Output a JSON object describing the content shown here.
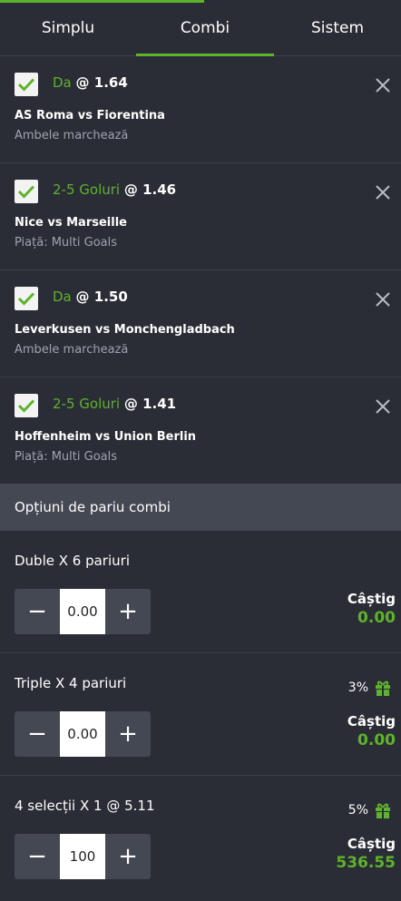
{
  "tabs": [
    {
      "label": "Simplu",
      "active": false
    },
    {
      "label": "Combi",
      "active": true
    },
    {
      "label": "Sistem",
      "active": false
    }
  ],
  "accent_color": "#5fb22c",
  "selections": [
    {
      "pick": "Da",
      "odds": "@ 1.64",
      "match": "AS Roma vs Fiorentina",
      "market": "Ambele marchează"
    },
    {
      "pick": "2-5 Goluri",
      "odds": "@ 1.46",
      "match": "Nice vs Marseille",
      "market": "Piață: Multi Goals"
    },
    {
      "pick": "Da",
      "odds": "@ 1.50",
      "match": "Leverkusen vs Monchengladbach",
      "market": "Ambele marchează"
    },
    {
      "pick": "2-5 Goluri",
      "odds": "@ 1.41",
      "match": "Hoffenheim vs Union Berlin",
      "market": "Piață: Multi Goals"
    }
  ],
  "options_title": "Opțiuni de pariu combi",
  "combos": [
    {
      "label": "Duble X 6 pariuri",
      "bonus": "",
      "stake": "0.00",
      "payout_label": "Câștig",
      "payout": "0.00"
    },
    {
      "label": "Triple X 4 pariuri",
      "bonus": "3%",
      "stake": "0.00",
      "payout_label": "Câștig",
      "payout": "0.00"
    },
    {
      "label": "4 selecții X 1 @ 5.11",
      "bonus": "5%",
      "stake": "100",
      "payout_label": "Câștig",
      "payout": "536.55"
    }
  ]
}
